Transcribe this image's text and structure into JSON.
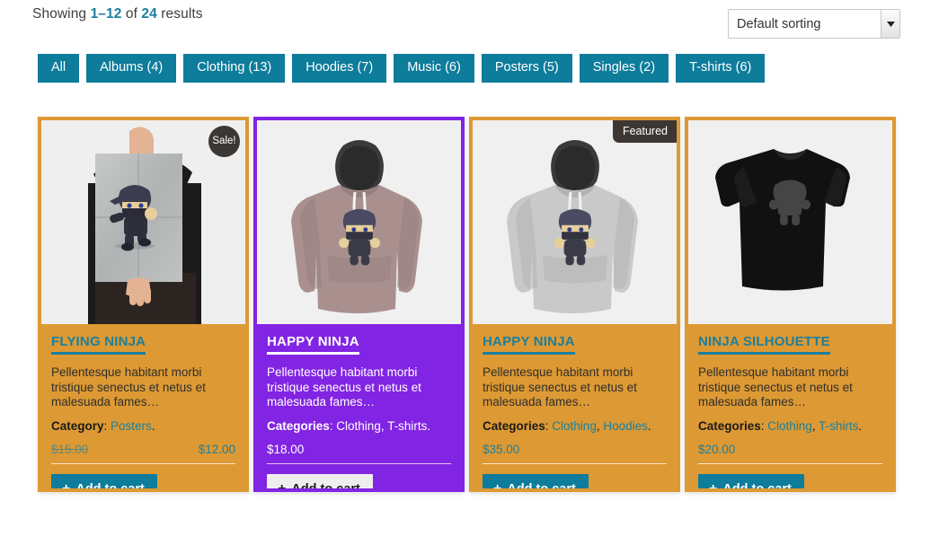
{
  "header": {
    "showing_prefix": "Showing ",
    "showing_range": "1–12",
    "showing_mid": " of ",
    "showing_total": "24",
    "showing_suffix": " results",
    "sorting_selected": "Default sorting",
    "sorting_icon": "chevron-down-icon"
  },
  "filters": {
    "tabs": [
      {
        "label": "All"
      },
      {
        "label": "Albums (4)"
      },
      {
        "label": "Clothing (13)"
      },
      {
        "label": "Hoodies (7)"
      },
      {
        "label": "Music (6)"
      },
      {
        "label": "Posters (5)"
      },
      {
        "label": "Singles (2)"
      },
      {
        "label": "T-shirts (6)"
      }
    ]
  },
  "colors": {
    "card_orange": "#dd9933",
    "card_purple": "#8224e3",
    "accent_teal": "#1b7f9e",
    "button_teal": "#0e7c9b",
    "badge_dark": "#3d3733"
  },
  "products": [
    {
      "title": "Flying Ninja",
      "description": "Pellentesque habitant morbi tristique senectus et netus et malesuada fames…",
      "category_label": "Category",
      "categories": [
        "Posters"
      ],
      "price_old": "$15.00",
      "price": "$12.00",
      "badge": "Sale!",
      "badge_type": "sale",
      "add_to_cart": "Add to cart",
      "theme": "orange",
      "image": "poster-held-by-person"
    },
    {
      "title": "Happy Ninja",
      "description": "Pellentesque habitant morbi tristique senectus et netus et malesuada fames…",
      "category_label": "Categories",
      "categories": [
        "Clothing",
        "T-shirts"
      ],
      "price_old": "",
      "price": "$18.00",
      "badge": "",
      "badge_type": "none",
      "add_to_cart": "Add to cart",
      "theme": "purple",
      "image": "mauve-hoodie"
    },
    {
      "title": "Happy Ninja",
      "description": "Pellentesque habitant morbi tristique senectus et netus et malesuada fames…",
      "category_label": "Categories",
      "categories": [
        "Clothing",
        "Hoodies"
      ],
      "price_old": "",
      "price": "$35.00",
      "badge": "Featured",
      "badge_type": "featured",
      "add_to_cart": "Add to cart",
      "theme": "orange",
      "image": "grey-hoodie"
    },
    {
      "title": "Ninja Silhouette",
      "description": "Pellentesque habitant morbi tristique senectus et netus et malesuada fames…",
      "category_label": "Categories",
      "categories": [
        "Clothing",
        "T-shirts"
      ],
      "price_old": "",
      "price": "$20.00",
      "badge": "",
      "badge_type": "none",
      "add_to_cart": "Add to cart",
      "theme": "orange",
      "image": "black-tshirt"
    }
  ]
}
